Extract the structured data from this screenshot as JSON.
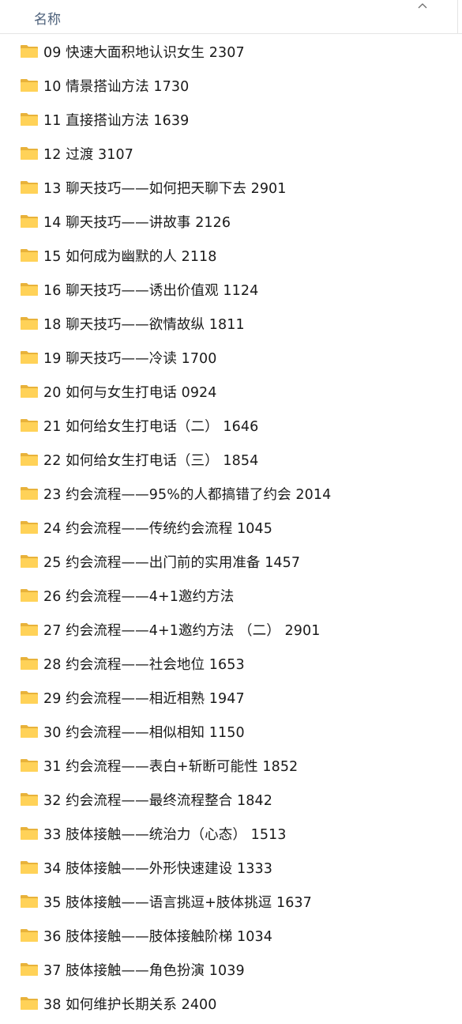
{
  "header": {
    "column_name": "名称"
  },
  "items": [
    "09 快速大面积地认识女生 2307",
    "10 情景搭讪方法 1730",
    "11 直接搭讪方法 1639",
    "12 过渡 3107",
    "13 聊天技巧——如何把天聊下去 2901",
    "14 聊天技巧——讲故事 2126",
    "15 如何成为幽默的人 2118",
    "16 聊天技巧——诱出价值观 1124",
    "18 聊天技巧——欲情故纵 1811",
    "19 聊天技巧——冷读 1700",
    "20 如何与女生打电话 0924",
    "21 如何给女生打电话（二） 1646",
    "22 如何给女生打电话（三） 1854",
    "23 约会流程——95%的人都搞错了约会 2014",
    "24 约会流程——传统约会流程 1045",
    "25 约会流程——出门前的实用准备 1457",
    "26 约会流程——4+1邀约方法",
    "27 约会流程——4+1邀约方法 （二） 2901",
    "28 约会流程——社会地位 1653",
    "29 约会流程——相近相熟 1947",
    "30 约会流程——相似相知 1150",
    "31 约会流程——表白+斩断可能性 1852",
    "32 约会流程——最终流程整合 1842",
    "33 肢体接触——统治力（心态） 1513",
    "34 肢体接触——外形快速建设 1333",
    "35 肢体接触——语言挑逗+肢体挑逗 1637",
    "36 肢体接触——肢体接触阶梯 1034",
    "37 肢体接触——角色扮演 1039",
    "38 如何维护长期关系 2400"
  ],
  "icons": {
    "item": "folder-icon",
    "header_sort": "chevron-up-icon"
  },
  "colors": {
    "folder": "#FFD258",
    "folder_dark": "#E8B23A",
    "header_text": "#4c607a"
  }
}
